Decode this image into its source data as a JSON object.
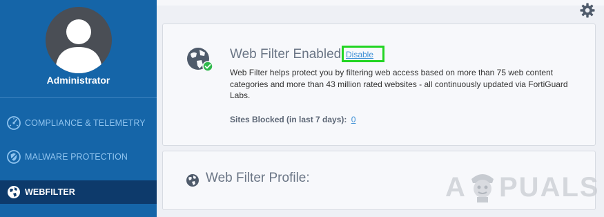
{
  "sidebar": {
    "user": {
      "name": "Administrator"
    },
    "items": [
      {
        "label": "COMPLIANCE & TELEMETRY",
        "icon": "speedometer-icon"
      },
      {
        "label": "MALWARE PROTECTION",
        "icon": "shield-icon"
      },
      {
        "label": "WEBFILTER",
        "icon": "globe-icon",
        "active": true
      }
    ]
  },
  "header": {
    "settings_icon": "gear-icon"
  },
  "webfilter": {
    "title": "Web Filter Enabled",
    "disable_label": "Disable",
    "description": "Web Filter helps protect you by filtering web access based on more than 75 web content categories and more than 43 million rated websites - all continuously updated via FortiGuard Labs.",
    "sites_blocked_label": "Sites Blocked (in last 7 days):",
    "sites_blocked_count": "0"
  },
  "profile": {
    "title": "Web Filter Profile:"
  },
  "watermark": {
    "a": "A",
    "rest": "PUALS"
  },
  "colors": {
    "sidebar": "#1565a8",
    "sidebar_active": "#0d3a6b",
    "link": "#3d8fd6",
    "highlight": "#22d522",
    "status_ok": "#2eb84b"
  }
}
